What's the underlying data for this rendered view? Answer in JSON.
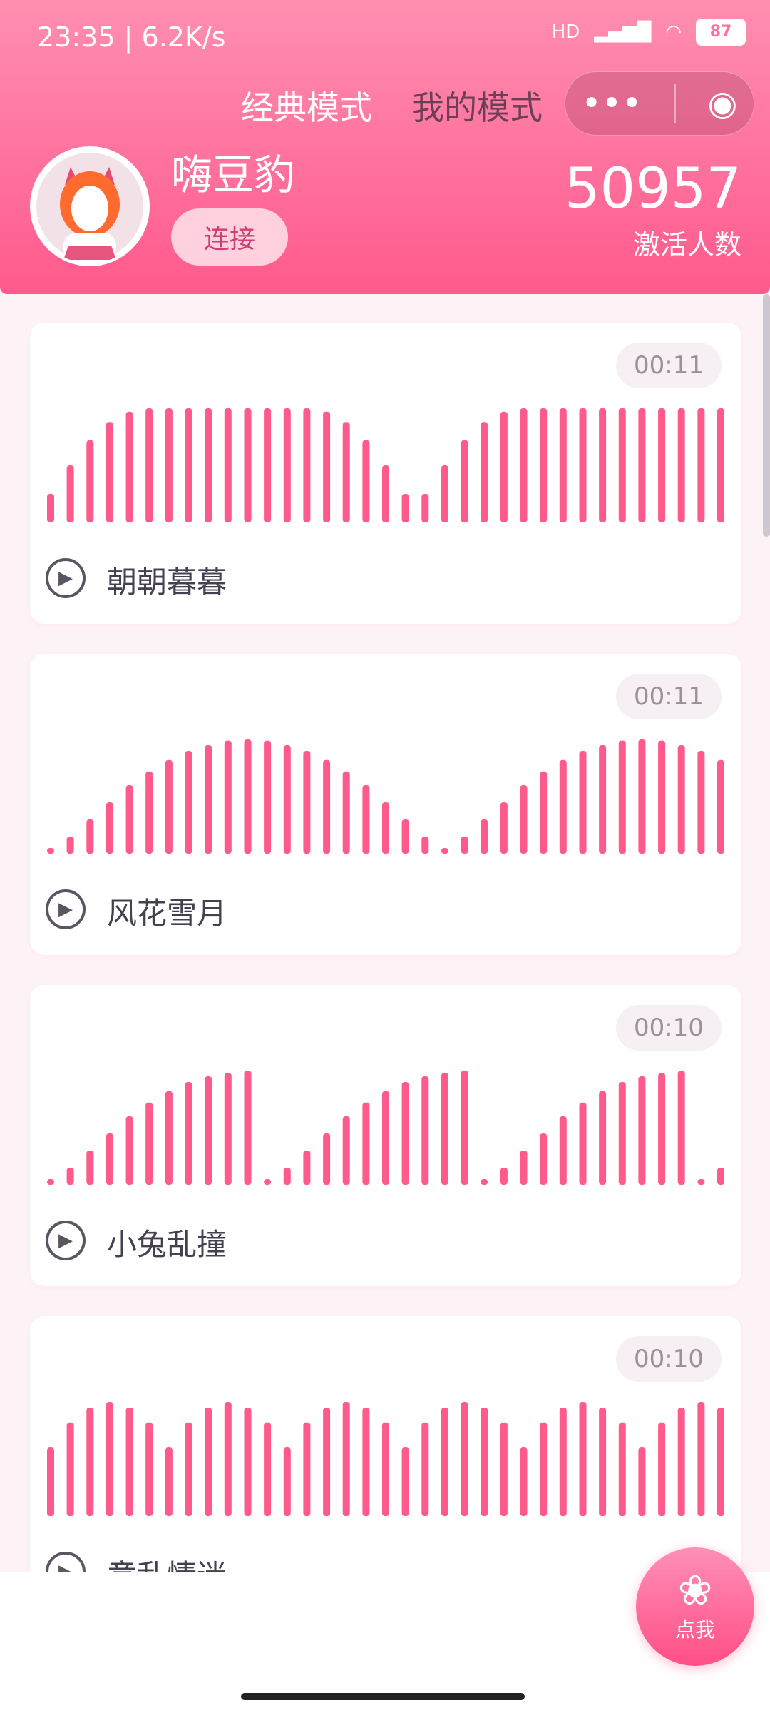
{
  "status": {
    "time": "23:35",
    "net": "6.2K/s",
    "hd": "HD",
    "battery": "87"
  },
  "nav": {
    "tabs": [
      "经典模式",
      "我的模式"
    ],
    "active_index": 1
  },
  "profile": {
    "name": "嗨豆豹",
    "connect_label": "连接",
    "count": "50957",
    "count_label": "激活人数"
  },
  "cards": [
    {
      "title": "朝朝暮暮",
      "duration": "00:11",
      "wave": [
        0.25,
        0.5,
        0.72,
        0.88,
        0.97,
        1,
        1,
        1,
        1,
        1,
        1,
        1,
        1,
        1,
        0.97,
        0.88,
        0.72,
        0.5,
        0.25,
        0.25,
        0.5,
        0.72,
        0.88,
        0.97,
        1,
        1,
        1,
        1,
        1,
        1,
        1,
        1,
        1,
        1,
        1
      ]
    },
    {
      "title": "风花雪月",
      "duration": "00:11",
      "wave": [
        0.05,
        0.15,
        0.3,
        0.45,
        0.6,
        0.72,
        0.82,
        0.9,
        0.95,
        0.99,
        1,
        0.99,
        0.95,
        0.9,
        0.82,
        0.72,
        0.6,
        0.45,
        0.3,
        0.15,
        0.05,
        0.15,
        0.3,
        0.45,
        0.6,
        0.72,
        0.82,
        0.9,
        0.95,
        0.99,
        1,
        0.99,
        0.95,
        0.9,
        0.82
      ]
    },
    {
      "title": "小兔乱撞",
      "duration": "00:10",
      "wave": [
        0.05,
        0.15,
        0.3,
        0.45,
        0.6,
        0.72,
        0.82,
        0.9,
        0.95,
        0.98,
        1,
        0.05,
        0.15,
        0.3,
        0.45,
        0.6,
        0.72,
        0.82,
        0.9,
        0.95,
        0.98,
        1,
        0.05,
        0.15,
        0.3,
        0.45,
        0.6,
        0.72,
        0.82,
        0.9,
        0.95,
        0.98,
        1,
        0.05,
        0.15
      ]
    },
    {
      "title": "意乱情迷",
      "duration": "00:10",
      "wave": [
        0.6,
        0.82,
        0.95,
        1,
        0.95,
        0.82,
        0.6,
        0.82,
        0.95,
        1,
        0.95,
        0.82,
        0.6,
        0.82,
        0.95,
        1,
        0.95,
        0.82,
        0.6,
        0.82,
        0.95,
        1,
        0.95,
        0.82,
        0.6,
        0.82,
        0.95,
        1,
        0.95,
        0.82,
        0.6,
        0.82,
        0.95,
        1,
        0.95
      ]
    }
  ],
  "fab": {
    "label": "点我"
  }
}
